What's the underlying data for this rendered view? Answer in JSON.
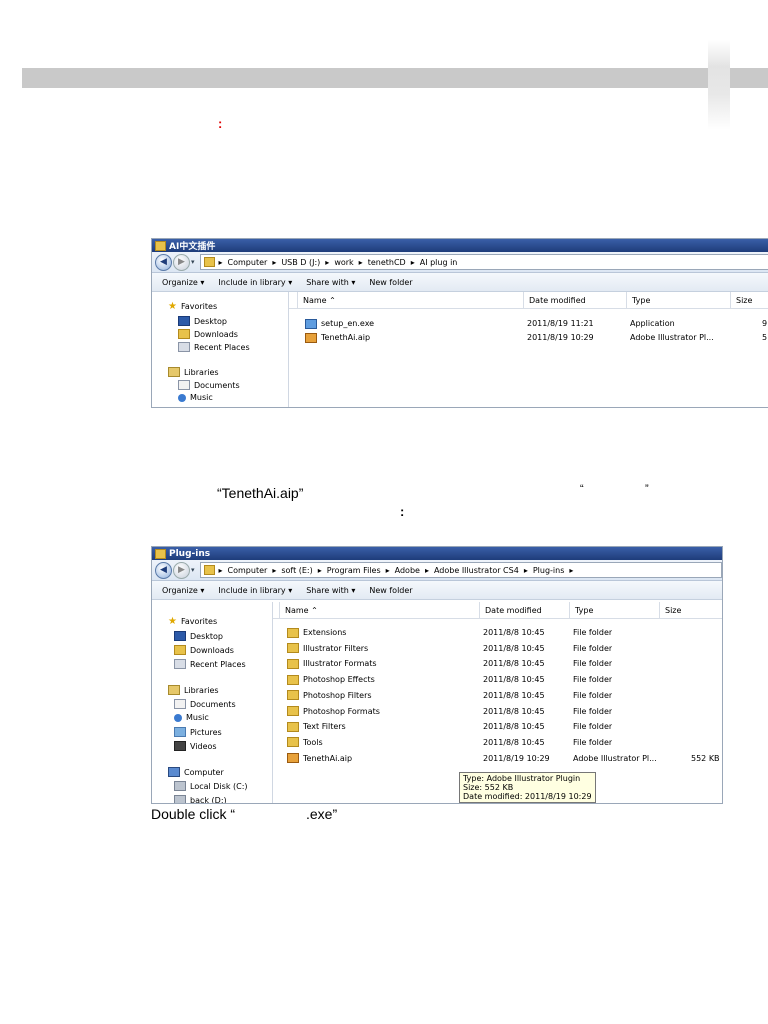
{
  "doc": {
    "colon_red": ":",
    "line1_file": "“TenethAi.aip”",
    "line1_quote_open": "“",
    "line1_quote_close": "”",
    "line2_colon": ":",
    "line3": "Double click “",
    "line3_end": ".exe”"
  },
  "colors": {
    "title_bar": "#1e3c7a",
    "header_bar": "#c9c9c9",
    "accent_red": "#e00000",
    "tooltip_bg": "#ffffe1"
  },
  "window1": {
    "title": "AI中文插件",
    "address": [
      "Computer",
      "USB D (J:)",
      "work",
      "tenethCD",
      "AI plug in"
    ],
    "toolbar": [
      "Organize ▾",
      "Include in library ▾",
      "Share with ▾",
      "New folder"
    ],
    "nav": {
      "favorites": "Favorites",
      "favorites_items": [
        "Desktop",
        "Downloads",
        "Recent Places"
      ],
      "libraries": "Libraries",
      "libraries_items": [
        "Documents",
        "Music"
      ]
    },
    "columns": [
      "Name",
      "Date modified",
      "Type",
      "Size"
    ],
    "files": [
      {
        "name": "setup_en.exe",
        "date": "2011/8/19 11:21",
        "type": "Application",
        "size": "9",
        "icon": "exe-icon"
      },
      {
        "name": "TenethAi.aip",
        "date": "2011/8/19 10:29",
        "type": "Adobe Illustrator Pl...",
        "size": "5",
        "icon": "aip-icon"
      }
    ]
  },
  "window2": {
    "title": "Plug-ins",
    "address": [
      "Computer",
      "soft (E:)",
      "Program Files",
      "Adobe",
      "Adobe Illustrator CS4",
      "Plug-ins"
    ],
    "toolbar": [
      "Organize ▾",
      "Include in library ▾",
      "Share with ▾",
      "New folder"
    ],
    "nav": {
      "favorites": "Favorites",
      "favorites_items": [
        "Desktop",
        "Downloads",
        "Recent Places"
      ],
      "libraries": "Libraries",
      "libraries_items": [
        "Documents",
        "Music",
        "Pictures",
        "Videos"
      ],
      "computer": "Computer",
      "computer_items": [
        "Local Disk (C:)",
        "back (D:)"
      ]
    },
    "columns": [
      "Name",
      "Date modified",
      "Type",
      "Size"
    ],
    "files": [
      {
        "name": "Extensions",
        "date": "2011/8/8 10:45",
        "type": "File folder",
        "size": ""
      },
      {
        "name": "Illustrator Filters",
        "date": "2011/8/8 10:45",
        "type": "File folder",
        "size": ""
      },
      {
        "name": "Illustrator Formats",
        "date": "2011/8/8 10:45",
        "type": "File folder",
        "size": ""
      },
      {
        "name": "Photoshop Effects",
        "date": "2011/8/8 10:45",
        "type": "File folder",
        "size": ""
      },
      {
        "name": "Photoshop Filters",
        "date": "2011/8/8 10:45",
        "type": "File folder",
        "size": ""
      },
      {
        "name": "Photoshop Formats",
        "date": "2011/8/8 10:45",
        "type": "File folder",
        "size": ""
      },
      {
        "name": "Text Filters",
        "date": "2011/8/8 10:45",
        "type": "File folder",
        "size": ""
      },
      {
        "name": "Tools",
        "date": "2011/8/8 10:45",
        "type": "File folder",
        "size": ""
      },
      {
        "name": "TenethAi.aip",
        "date": "2011/8/19 10:29",
        "type": "Adobe Illustrator Pl...",
        "size": "552 KB"
      }
    ],
    "tooltip": [
      "Type: Adobe Illustrator Plugin",
      "Size: 552 KB",
      "Date modified: 2011/8/19 10:29"
    ]
  }
}
